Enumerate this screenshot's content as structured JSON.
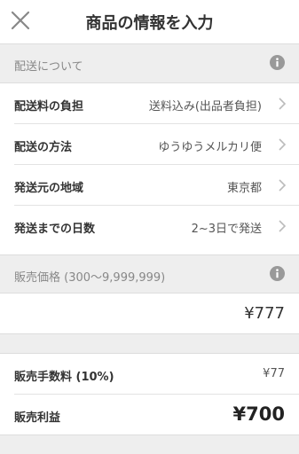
{
  "header": {
    "title": "商品の情報を入力",
    "close_icon": "close-icon"
  },
  "shipping_section": {
    "label": "配送について",
    "info_icon": "info-icon",
    "rows": [
      {
        "label": "配送料の負担",
        "value": "送料込み(出品者負担)"
      },
      {
        "label": "配送の方法",
        "value": "ゆうゆうメルカリ便"
      },
      {
        "label": "発送元の地域",
        "value": "東京都"
      },
      {
        "label": "発送までの日数",
        "value": "2~3日で発送"
      }
    ]
  },
  "price_section": {
    "label": "販売価格 (300〜9,999,999)",
    "info_icon": "info-icon",
    "price_value": "¥777"
  },
  "fee": {
    "label": "販売手数料 (10%)",
    "value": "¥77"
  },
  "profit": {
    "label": "販売利益",
    "value": "¥700"
  },
  "colors": {
    "section_bg": "#eeeeee",
    "text": "#333333",
    "muted": "#888888"
  }
}
